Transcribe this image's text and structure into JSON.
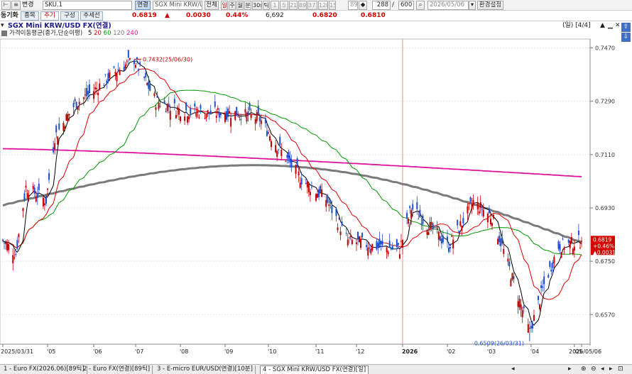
{
  "toolbar": {
    "mode_label": "변경",
    "symbol_code": "SKU.1",
    "contract_type_label": "연결",
    "instrument_name": "SGX Mini KRW/USI",
    "all_label": "전체",
    "period_buttons": [
      {
        "label": "일",
        "active": true
      },
      {
        "label": "주",
        "active": false
      },
      {
        "label": "월",
        "active": false
      },
      {
        "label": "분",
        "active": false
      },
      {
        "label": "30s",
        "active": false
      },
      {
        "label": "틱",
        "active": false
      },
      {
        "label": "1",
        "active": false
      },
      {
        "label": "5",
        "active": false
      },
      {
        "label": "21",
        "active": false
      },
      {
        "label": "89",
        "active": false
      },
      {
        "label": "377",
        "active": false
      },
      {
        "label": "120",
        "active": false
      },
      {
        "label": "15",
        "active": false
      }
    ],
    "interval_input": "89",
    "display_count": "288",
    "total_count": "600",
    "date_value": "2026/05/06",
    "layout_value": "4",
    "settings_label": "환경설정"
  },
  "subbar": {
    "sync_label": "동기화",
    "tabs": [
      "종목",
      "주기",
      "구성",
      "추세선"
    ],
    "last_price": "0.6819",
    "change_arrow": "▲",
    "change_value": "0.0030",
    "change_pct": "0.44%",
    "volume": "6,692",
    "ask_price": "0.6820",
    "bid_price": "0.6810"
  },
  "chart_header": {
    "title": "SGX Mini KRW/USD FX(연결)",
    "period_info": "(일) [4/4]",
    "indicator_name": "가격이동평균(종가,단순이평)",
    "ma_periods": [
      "5",
      "20",
      "60",
      "120",
      "240"
    ],
    "ma_colors": [
      "#000000",
      "#e00000",
      "#009900",
      "#7a7a7a",
      "#e0119d"
    ],
    "up_color": "#c00000",
    "down_color": "#1f4fd0"
  },
  "annotations": {
    "high_label": "0.7432(25/06/30)",
    "low_label": "0.6509(26/03/31)",
    "last_box": [
      "0.6819",
      "+0.46%",
      "▲0.0031"
    ]
  },
  "chart_data": {
    "type": "candlestick",
    "title": "SGX Mini KRW/USD FX(연결)",
    "ylim": [
      0.647,
      0.75
    ],
    "y_ticks": [
      "0.7470",
      "0.7290",
      "0.7110",
      "0.6930",
      "0.6750",
      "0.6570"
    ],
    "x_ticks": [
      "2025/03/31",
      "'05",
      "'06",
      "'07",
      "'08",
      "'09",
      "'10",
      "'11",
      "'12",
      "2026",
      "'02",
      "'03",
      "'04",
      "'05",
      "2026/05/06"
    ],
    "year_divider": "2026",
    "close_path": [
      {
        "x": "2025/03/31",
        "close": 0.682
      },
      {
        "x": "2025/04/09",
        "close": 0.6775
      },
      {
        "x": "2025/04/16",
        "close": 0.7
      },
      {
        "x": "2025/04/30",
        "close": 0.6955
      },
      {
        "x": "2025/05/06",
        "close": 0.717
      },
      {
        "x": "2025/05/20",
        "close": 0.728
      },
      {
        "x": "2025/06/03",
        "close": 0.733
      },
      {
        "x": "2025/06/17",
        "close": 0.739
      },
      {
        "x": "2025/06/30",
        "close": 0.7432
      },
      {
        "x": "2025/07/15",
        "close": 0.729
      },
      {
        "x": "2025/08/01",
        "close": 0.726
      },
      {
        "x": "2025/08/20",
        "close": 0.725
      },
      {
        "x": "2025/09/10",
        "close": 0.725
      },
      {
        "x": "2025/09/25",
        "close": 0.723
      },
      {
        "x": "2025/10/10",
        "close": 0.712
      },
      {
        "x": "2025/10/25",
        "close": 0.702
      },
      {
        "x": "2025/11/10",
        "close": 0.696
      },
      {
        "x": "2025/11/25",
        "close": 0.682
      },
      {
        "x": "2025/12/15",
        "close": 0.68
      },
      {
        "x": "2025/12/31",
        "close": 0.679
      },
      {
        "x": "2026/01/08",
        "close": 0.693
      },
      {
        "x": "2026/01/20",
        "close": 0.687
      },
      {
        "x": "2026/02/03",
        "close": 0.68
      },
      {
        "x": "2026/02/20",
        "close": 0.695
      },
      {
        "x": "2026/03/05",
        "close": 0.69
      },
      {
        "x": "2026/03/12",
        "close": 0.68
      },
      {
        "x": "2026/03/31",
        "close": 0.6509
      },
      {
        "x": "2026/04/10",
        "close": 0.667
      },
      {
        "x": "2026/04/20",
        "close": 0.68
      },
      {
        "x": "2026/05/06",
        "close": 0.6819
      }
    ],
    "moving_averages": [
      {
        "period": "5",
        "color": "#000000"
      },
      {
        "period": "20",
        "color": "#e00000"
      },
      {
        "period": "60",
        "color": "#009900"
      },
      {
        "period": "120",
        "color": "#7a7a7a"
      },
      {
        "period": "240",
        "color": "#e0119d"
      }
    ]
  },
  "bottom_tabs": [
    {
      "label": "1 - Euro FX(2026.06)[89틱]",
      "active": false
    },
    {
      "label": "2 - Euro FX(연결)[89틱]",
      "active": false
    },
    {
      "label": "3 - E-micro EUR/USD(연결)[10분]",
      "active": false
    },
    {
      "label": "4 - SGX Mini KRW/USD FX(연결)[일]",
      "active": true
    }
  ]
}
